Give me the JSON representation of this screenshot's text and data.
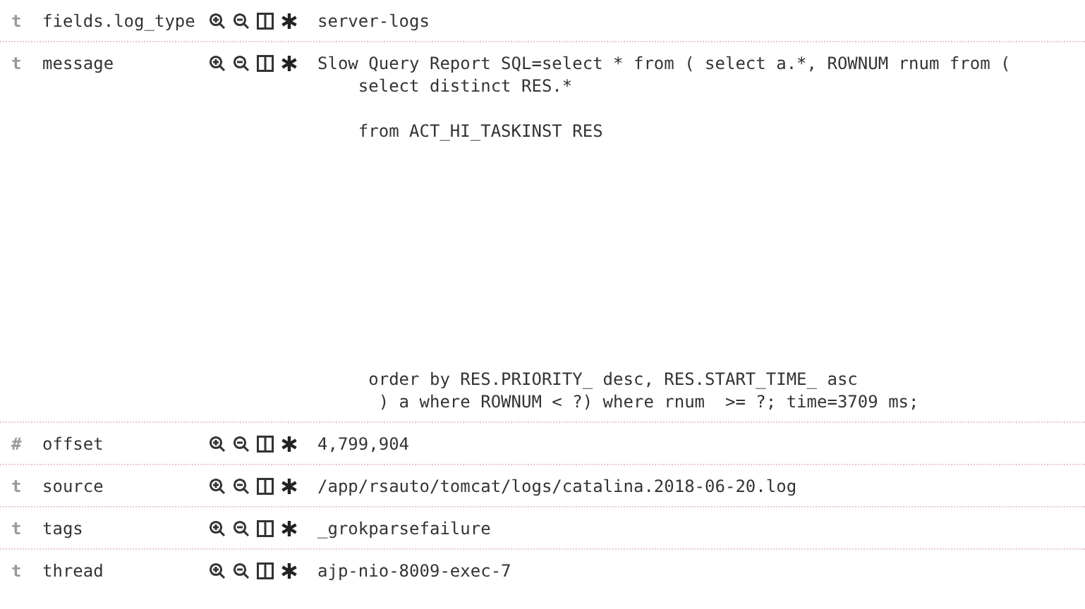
{
  "fields": [
    {
      "type_icon": "t",
      "name": "fields.log_type",
      "value": "server-logs"
    },
    {
      "type_icon": "t",
      "name": "message",
      "value": "Slow Query Report SQL=select * from ( select a.*, ROWNUM rnum from (\n    select distinct RES.*\n\n    from ACT_HI_TASKINST RES\n\n\n\n\n\n\n\n\n\n\n     order by RES.PRIORITY_ desc, RES.START_TIME_ asc\n      ) a where ROWNUM < ?) where rnum  >= ?; time=3709 ms;"
    },
    {
      "type_icon": "#",
      "name": "offset",
      "value": "4,799,904"
    },
    {
      "type_icon": "t",
      "name": "source",
      "value": "/app/rsauto/tomcat/logs/catalina.2018-06-20.log"
    },
    {
      "type_icon": "t",
      "name": "tags",
      "value": "_grokparsefailure"
    },
    {
      "type_icon": "t",
      "name": "thread",
      "value": "ajp-nio-8009-exec-7"
    }
  ]
}
